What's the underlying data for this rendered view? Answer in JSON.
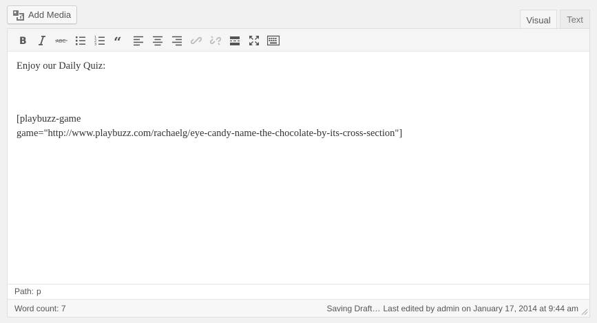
{
  "toolbar_top": {
    "add_media_label": "Add Media"
  },
  "tabs": [
    {
      "label": "Visual"
    },
    {
      "label": "Text"
    }
  ],
  "editor_toolbar": {
    "buttons": [
      {
        "name": "bold",
        "icon": "bold-icon"
      },
      {
        "name": "italic",
        "icon": "italic-icon"
      },
      {
        "name": "strikethrough",
        "icon": "strikethrough-icon"
      },
      {
        "name": "bulleted-list",
        "icon": "bulleted-list-icon"
      },
      {
        "name": "numbered-list",
        "icon": "numbered-list-icon"
      },
      {
        "name": "blockquote",
        "icon": "blockquote-icon"
      },
      {
        "name": "align-left",
        "icon": "align-left-icon"
      },
      {
        "name": "align-center",
        "icon": "align-center-icon"
      },
      {
        "name": "align-right",
        "icon": "align-right-icon"
      },
      {
        "name": "insert-link",
        "icon": "link-icon"
      },
      {
        "name": "remove-link",
        "icon": "unlink-icon"
      },
      {
        "name": "read-more",
        "icon": "read-more-icon"
      },
      {
        "name": "fullscreen",
        "icon": "fullscreen-icon"
      },
      {
        "name": "toolbar-toggle",
        "icon": "kitchen-sink-icon"
      }
    ]
  },
  "content": {
    "paragraph1": "Enjoy our Daily Quiz:",
    "shortcode_line1": "[playbuzz-game",
    "shortcode_line2": "game=\"http://www.playbuzz.com/rachaelg/eye-candy-name-the-chocolate-by-its-cross-section\"]"
  },
  "path_bar": {
    "label": "Path:",
    "value": "p"
  },
  "status": {
    "word_count_label": "Word count:",
    "word_count": "7",
    "saving": "Saving Draft…",
    "last_edited": "Last edited by admin on January 17, 2014 at 9:44 am"
  }
}
